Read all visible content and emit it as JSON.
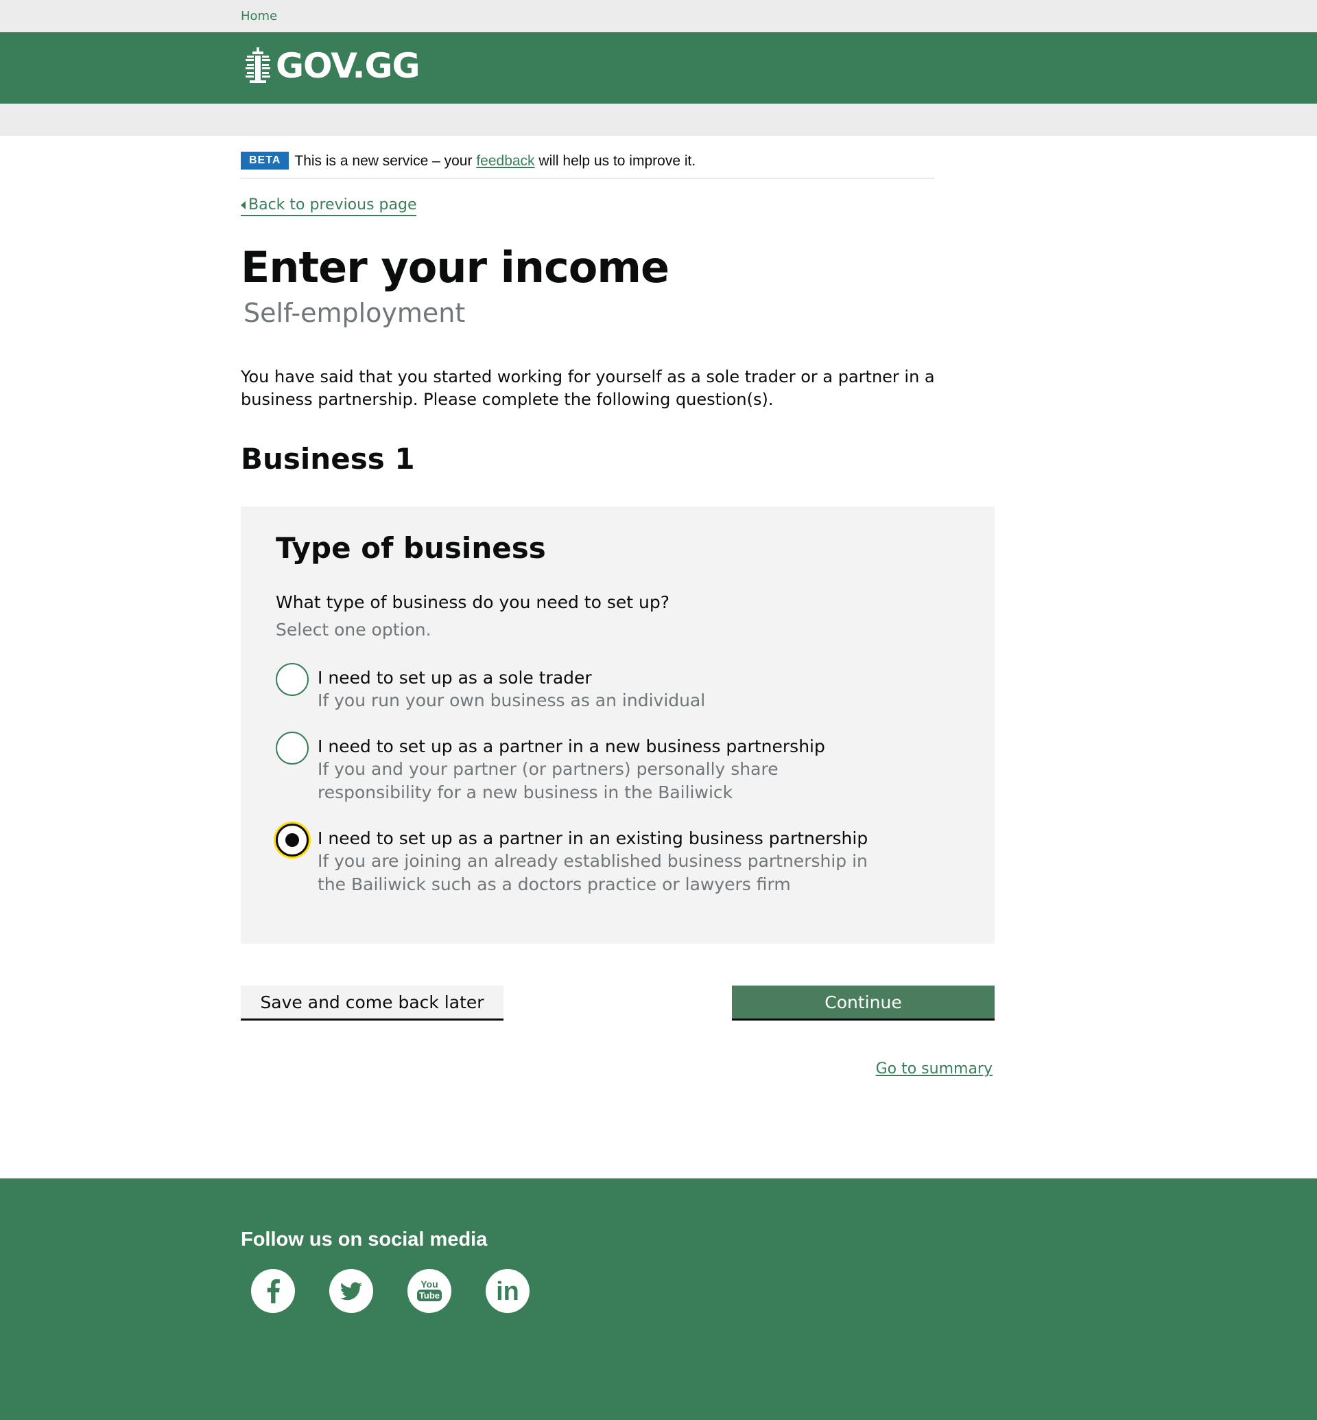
{
  "topbar": {
    "home_label": "Home"
  },
  "masthead": {
    "logo_text": "GOV.GG"
  },
  "beta": {
    "tag": "BETA",
    "text_before": "This is a new service – your",
    "link": "feedback",
    "text_after": "will help us to improve it."
  },
  "back_link": "Back to previous page",
  "page": {
    "title": "Enter your income",
    "caption": "Self-employment",
    "lead": "You have said that you started working for yourself as a sole trader or a partner in a business partnership. Please complete the following question(s).",
    "section": "Business 1"
  },
  "panel": {
    "title": "Type of business",
    "question": "What type of business do you need to set up?",
    "hint": "Select one option.",
    "options": [
      {
        "label": "I need to set up as a sole trader",
        "hint": "If you run your own business as an individual",
        "checked": false
      },
      {
        "label": "I need to set up as a partner in a new business partnership",
        "hint": "If you and your partner (or partners) personally share responsibility for a new business in the Bailiwick",
        "checked": false
      },
      {
        "label": "I need to set up as a partner in an existing business partnership",
        "hint": "If you are joining an already established business partnership in the Bailiwick such as a doctors practice or lawyers firm",
        "checked": true
      }
    ]
  },
  "actions": {
    "save_label": "Save and come back later",
    "continue_label": "Continue",
    "summary_link": "Go to summary"
  },
  "footer": {
    "title": "Follow us on social media",
    "social": [
      {
        "name": "facebook-icon"
      },
      {
        "name": "twitter-icon"
      },
      {
        "name": "youtube-icon",
        "text_top": "You",
        "text_bottom": "Tube"
      },
      {
        "name": "linkedin-icon",
        "text": "in"
      }
    ]
  },
  "colors": {
    "brand_green": "#3a7d59",
    "beta_blue": "#1d70b8",
    "focus_yellow": "#ffdd00"
  }
}
